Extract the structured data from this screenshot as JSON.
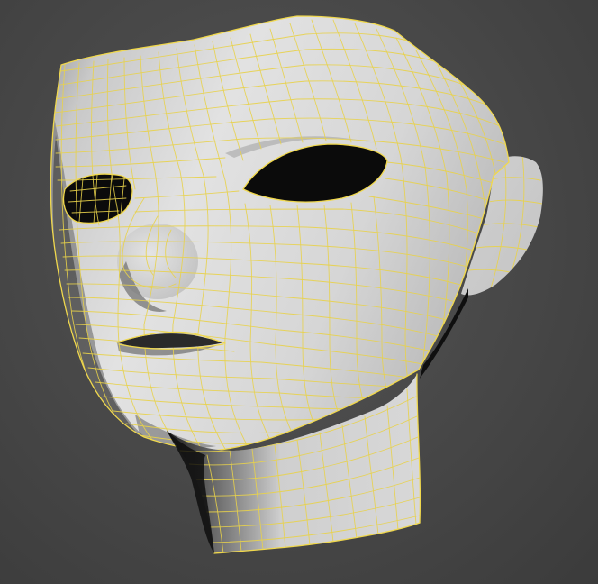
{
  "viewport": {
    "background": "#484848",
    "mesh_surface_color": "#d9d9d9",
    "wireframe_color": "#e8d24a",
    "shadow_color": "#111111"
  },
  "model": {
    "subject": "head-mesh",
    "display_mode": "shaded-with-edged-faces"
  }
}
